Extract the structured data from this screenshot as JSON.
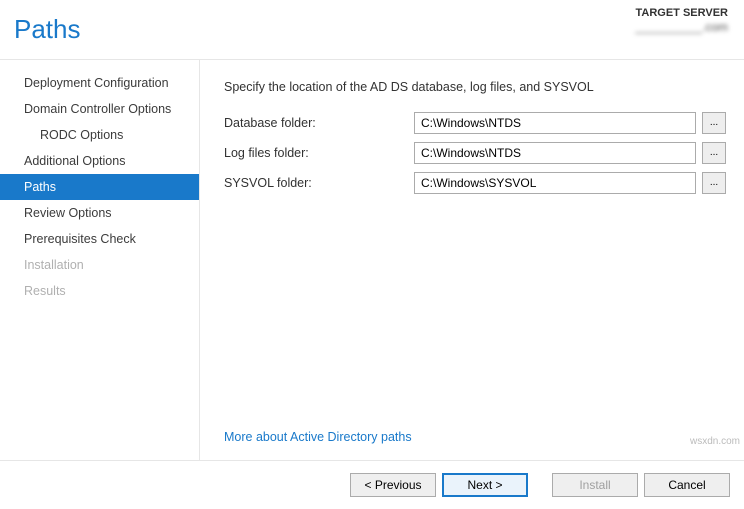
{
  "header": {
    "title": "Paths",
    "server_label": "TARGET SERVER",
    "server_name": "__________.com"
  },
  "sidebar": {
    "items": [
      {
        "label": "Deployment Configuration",
        "indent": false,
        "selected": false,
        "disabled": false
      },
      {
        "label": "Domain Controller Options",
        "indent": false,
        "selected": false,
        "disabled": false
      },
      {
        "label": "RODC Options",
        "indent": true,
        "selected": false,
        "disabled": false
      },
      {
        "label": "Additional Options",
        "indent": false,
        "selected": false,
        "disabled": false
      },
      {
        "label": "Paths",
        "indent": false,
        "selected": true,
        "disabled": false
      },
      {
        "label": "Review Options",
        "indent": false,
        "selected": false,
        "disabled": false
      },
      {
        "label": "Prerequisites Check",
        "indent": false,
        "selected": false,
        "disabled": false
      },
      {
        "label": "Installation",
        "indent": false,
        "selected": false,
        "disabled": true
      },
      {
        "label": "Results",
        "indent": false,
        "selected": false,
        "disabled": true
      }
    ]
  },
  "content": {
    "instruction": "Specify the location of the AD DS database, log files, and SYSVOL",
    "fields": {
      "database": {
        "label": "Database folder:",
        "value": "C:\\Windows\\NTDS",
        "browse": "..."
      },
      "logfiles": {
        "label": "Log files folder:",
        "value": "C:\\Windows\\NTDS",
        "browse": "..."
      },
      "sysvol": {
        "label": "SYSVOL folder:",
        "value": "C:\\Windows\\SYSVOL",
        "browse": "..."
      }
    },
    "more_link": "More about Active Directory paths"
  },
  "footer": {
    "previous": "< Previous",
    "next": "Next >",
    "install": "Install",
    "cancel": "Cancel"
  },
  "watermark": "wsxdn.com"
}
